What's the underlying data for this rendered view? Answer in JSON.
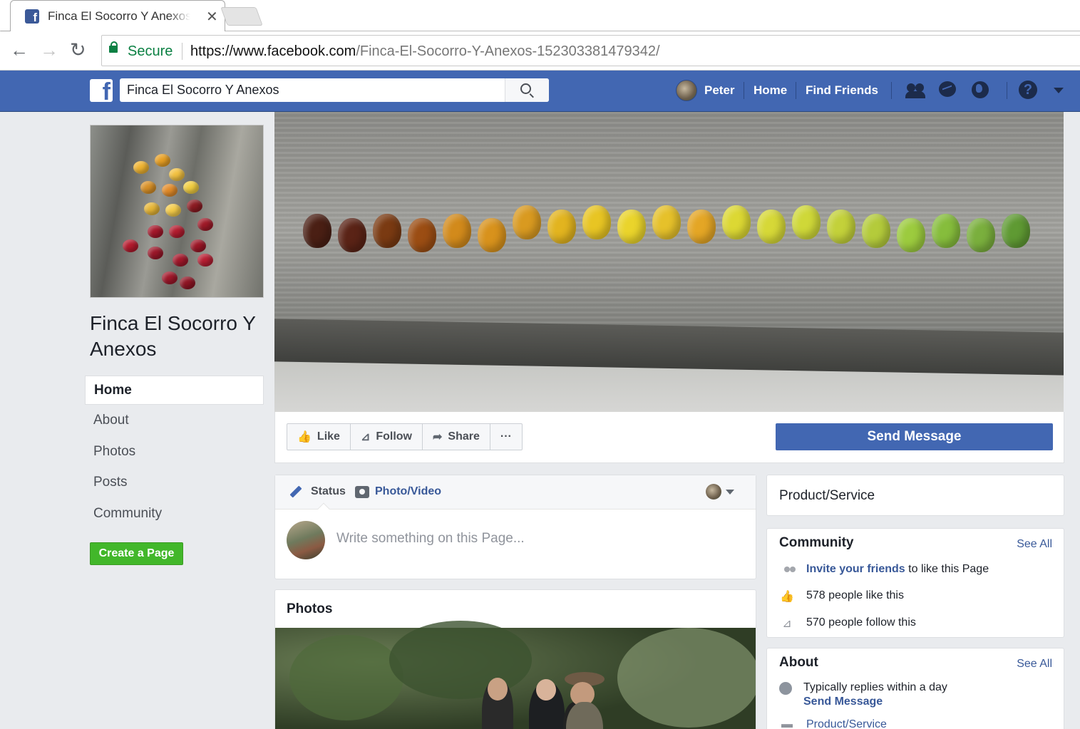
{
  "browser": {
    "tab_title": "Finca El Socorro Y Anexos",
    "secure_label": "Secure",
    "url_scheme_host": "https://www.facebook.com",
    "url_path": "/Finca-El-Socorro-Y-Anexos-152303381479342/"
  },
  "fb_header": {
    "search_value": "Finca El Socorro Y Anexos",
    "user_name": "Peter",
    "home_label": "Home",
    "find_friends_label": "Find Friends"
  },
  "page": {
    "name": "Finca El Socorro Y Anexos",
    "nav": [
      {
        "label": "Home",
        "active": true
      },
      {
        "label": "About"
      },
      {
        "label": "Photos"
      },
      {
        "label": "Posts"
      },
      {
        "label": "Community"
      }
    ],
    "create_page_label": "Create a Page"
  },
  "actions": {
    "like_label": "Like",
    "follow_label": "Follow",
    "share_label": "Share",
    "more_label": "···",
    "send_message_label": "Send Message"
  },
  "composer": {
    "status_label": "Status",
    "photo_video_label": "Photo/Video",
    "placeholder": "Write something on this Page..."
  },
  "photos": {
    "title": "Photos"
  },
  "sidebar_right": {
    "category": "Product/Service",
    "community": {
      "title": "Community",
      "see_all": "See All",
      "invite_link": "Invite your friends",
      "invite_rest": " to like this Page",
      "likes_text": "578 people like this",
      "follows_text": "570 people follow this"
    },
    "about": {
      "title": "About",
      "see_all": "See All",
      "replies_text": "Typically replies within a day",
      "send_message_link": "Send Message",
      "category_text": "Product/Service"
    }
  },
  "colors": {
    "fb_blue": "#4267b2",
    "link_blue": "#385898",
    "green_button": "#42b72a",
    "page_bg": "#e9ebee"
  }
}
